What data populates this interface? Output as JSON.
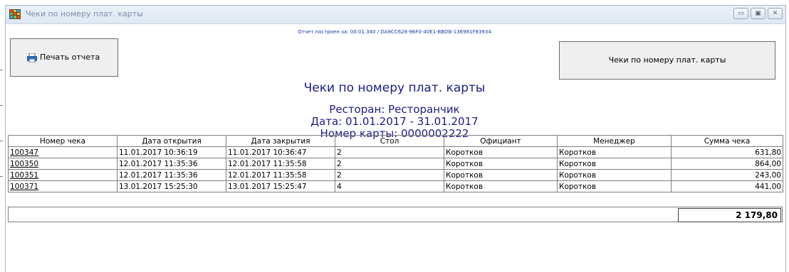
{
  "window": {
    "title": "Чеки по номеру плат. карты",
    "controls": {
      "minimize": "▭",
      "maximize": "▣",
      "close": "✕"
    }
  },
  "report": {
    "build_info": "Отчет построен за: 00:01.340 / DA9CC628-96F0-40E1-BBDB-136981F83934",
    "print_button": "Печать отчета",
    "name_button": "Чеки по номеру плат. карты",
    "title": "Чеки по номеру плат. карты",
    "restaurant": "Ресторан: Ресторанчик",
    "date_range": "Дата: 01.01.2017 - 31.01.2017",
    "card_number": "Номер карты: 0000002222"
  },
  "table": {
    "columns": [
      "Номер чека",
      "Дата открытия",
      "Дата закрытия",
      "Стол",
      "Официант",
      "Менеджер",
      "Сумма чека"
    ],
    "rows": [
      [
        "100347",
        "11.01.2017 10:36:19",
        "11.01.2017 10:36:47",
        "2",
        "Коротков",
        "Коротков",
        "631,80"
      ],
      [
        "100350",
        "12.01.2017 11:35:36",
        "12.01.2017 11:35:58",
        "2",
        "Коротков",
        "Коротков",
        "864,00"
      ],
      [
        "100351",
        "12.01.2017 11:35:36",
        "12.01.2017 11:35:58",
        "2",
        "Коротков",
        "Коротков",
        "243,00"
      ],
      [
        "100371",
        "13.01.2017 15:25:30",
        "13.01.2017 15:25:47",
        "4",
        "Коротков",
        "Коротков",
        "441,00"
      ]
    ],
    "total": "2 179,80"
  },
  "icons": {
    "app": "app-grid-icon",
    "print": "printer-icon"
  },
  "colors": {
    "report_text": "#1c1c82",
    "build_info": "#1a3aa6",
    "titlebar": "#dfe8f3"
  }
}
